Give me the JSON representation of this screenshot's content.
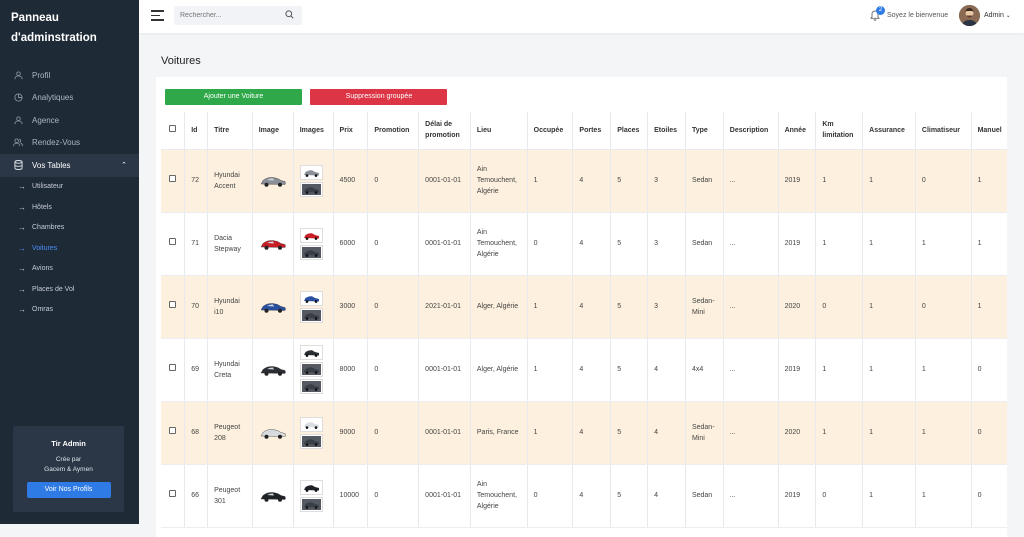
{
  "sidebar": {
    "brand_line1": "Panneau",
    "brand_line2": "d'adminstration",
    "items": [
      {
        "label": "Profil",
        "icon": "user-icon"
      },
      {
        "label": "Analytiques",
        "icon": "chart-pie-icon"
      },
      {
        "label": "Agence",
        "icon": "user-icon"
      },
      {
        "label": "Rendez-Vous",
        "icon": "users-icon"
      },
      {
        "label": "Vos Tables",
        "icon": "database-icon"
      }
    ],
    "sub_items": [
      {
        "label": "Utilisateur"
      },
      {
        "label": "Hôtels"
      },
      {
        "label": "Chambres"
      },
      {
        "label": "Voitures"
      },
      {
        "label": "Avions"
      },
      {
        "label": "Places de Vol"
      },
      {
        "label": "Omras"
      }
    ],
    "promo": {
      "title": "Tir Admin",
      "line1": "Crée par",
      "line2": "Gacem & Aymen",
      "button": "Voir Nos Profils"
    }
  },
  "topbar": {
    "search_placeholder": "Rechercher...",
    "notification_count": "2",
    "welcome": "Soyez le bienvenue",
    "user": "Admin"
  },
  "page": {
    "title": "Voitures",
    "add_button": "Ajouter une Voiture",
    "delete_button": "Suppression groupée"
  },
  "table": {
    "headers": [
      "Id",
      "Titre",
      "Image",
      "Images",
      "Prix",
      "Promotion",
      "Délai de promotion",
      "Lieu",
      "Occupée",
      "Portes",
      "Places",
      "Etoiles",
      "Type",
      "Description",
      "Année",
      "Km limitation",
      "Assurance",
      "Climatiseur",
      "Manuel"
    ],
    "rows": [
      {
        "id": "72",
        "titre": "Hyundai Accent",
        "prix": "4500",
        "promotion": "0",
        "delai": "0001-01-01",
        "lieu": "Ain Temouchent, Algérie",
        "occupee": "1",
        "portes": "4",
        "places": "5",
        "etoiles": "3",
        "type": "Sedan",
        "description": "...",
        "annee": "2019",
        "km": "1",
        "assurance": "1",
        "climatiseur": "0",
        "manuel": "1",
        "car_color": "#8a8f98",
        "thumb_count": 2
      },
      {
        "id": "71",
        "titre": "Dacia Stepway",
        "prix": "6000",
        "promotion": "0",
        "delai": "0001-01-01",
        "lieu": "Ain Temouchent, Algérie",
        "occupee": "0",
        "portes": "4",
        "places": "5",
        "etoiles": "3",
        "type": "Sedan",
        "description": "...",
        "annee": "2019",
        "km": "1",
        "assurance": "1",
        "climatiseur": "1",
        "manuel": "1",
        "car_color": "#c81d25",
        "thumb_count": 2
      },
      {
        "id": "70",
        "titre": "Hyundai i10",
        "prix": "3000",
        "promotion": "0",
        "delai": "2021-01-01",
        "lieu": "Alger, Algérie",
        "occupee": "1",
        "portes": "4",
        "places": "5",
        "etoiles": "3",
        "type": "Sedan-Mini",
        "description": "...",
        "annee": "2020",
        "km": "0",
        "assurance": "1",
        "climatiseur": "0",
        "manuel": "1",
        "car_color": "#2a4fa0",
        "thumb_count": 2
      },
      {
        "id": "69",
        "titre": "Hyundai Creta",
        "prix": "8000",
        "promotion": "0",
        "delai": "0001-01-01",
        "lieu": "Alger, Algérie",
        "occupee": "1",
        "portes": "4",
        "places": "5",
        "etoiles": "4",
        "type": "4x4",
        "description": "...",
        "annee": "2019",
        "km": "1",
        "assurance": "1",
        "climatiseur": "1",
        "manuel": "0",
        "car_color": "#2a2d33",
        "thumb_count": 3
      },
      {
        "id": "68",
        "titre": "Peugeot 208",
        "prix": "9000",
        "promotion": "0",
        "delai": "0001-01-01",
        "lieu": "Paris, France",
        "occupee": "1",
        "portes": "4",
        "places": "5",
        "etoiles": "4",
        "type": "Sedan-Mini",
        "description": "...",
        "annee": "2020",
        "km": "1",
        "assurance": "1",
        "climatiseur": "1",
        "manuel": "0",
        "car_color": "#d9dcdf",
        "thumb_count": 2
      },
      {
        "id": "66",
        "titre": "Peugeot 301",
        "prix": "10000",
        "promotion": "0",
        "delai": "0001-01-01",
        "lieu": "Ain Temouchent, Algérie",
        "occupee": "0",
        "portes": "4",
        "places": "5",
        "etoiles": "4",
        "type": "Sedan",
        "description": "...",
        "annee": "2019",
        "km": "0",
        "assurance": "1",
        "climatiseur": "1",
        "manuel": "0",
        "car_color": "#1e2126",
        "thumb_count": 2
      }
    ]
  },
  "colors": {
    "sidebar_bg": "#1f2a37",
    "accent_blue": "#2f7be5",
    "add_green": "#2fa84a",
    "delete_red": "#dc3545",
    "row_highlight": "#fdf0de"
  }
}
